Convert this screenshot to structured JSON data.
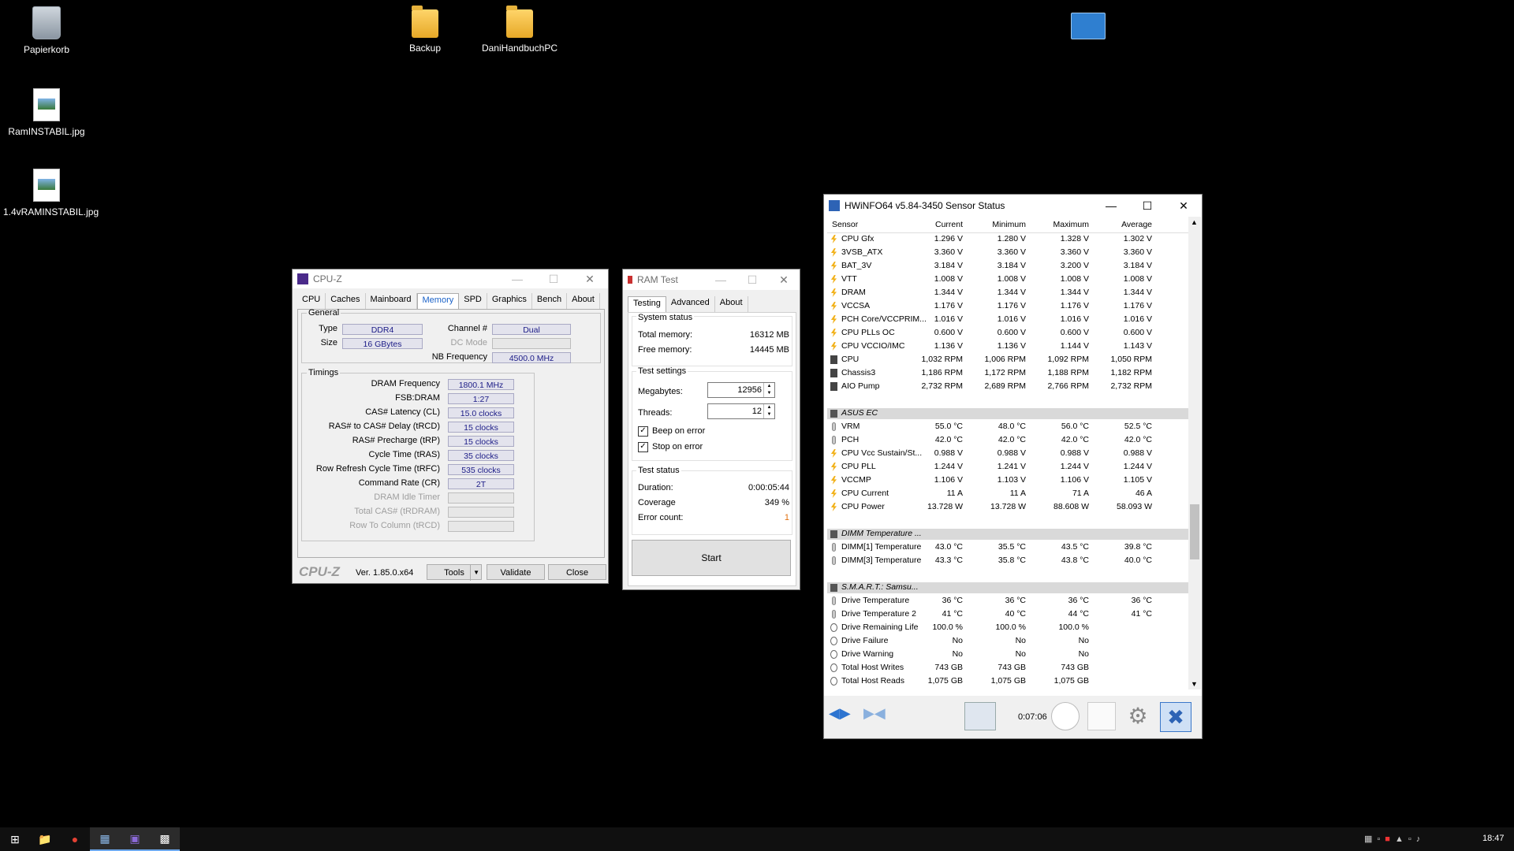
{
  "desktop": {
    "icons": [
      {
        "label": "Papierkorb"
      },
      {
        "label": "Backup"
      },
      {
        "label": "DaniHandbuchPC"
      },
      {
        "label": "RamINSTABIL.jpg"
      },
      {
        "label": "1.4vRAMINSTABIL.jpg"
      }
    ]
  },
  "cpuz": {
    "title": "CPU-Z",
    "tabs": [
      "CPU",
      "Caches",
      "Mainboard",
      "Memory",
      "SPD",
      "Graphics",
      "Bench",
      "About"
    ],
    "active_tab": "Memory",
    "general": {
      "legend": "General",
      "type_label": "Type",
      "type_value": "DDR4",
      "size_label": "Size",
      "size_value": "16 GBytes",
      "channel_label": "Channel #",
      "channel_value": "Dual",
      "dcmode_label": "DC Mode",
      "dcmode_value": "",
      "nbfreq_label": "NB Frequency",
      "nbfreq_value": "4500.0 MHz"
    },
    "timings": {
      "legend": "Timings",
      "rows": [
        {
          "label": "DRAM Frequency",
          "value": "1800.1 MHz"
        },
        {
          "label": "FSB:DRAM",
          "value": "1:27"
        },
        {
          "label": "CAS# Latency (CL)",
          "value": "15.0 clocks"
        },
        {
          "label": "RAS# to CAS# Delay (tRCD)",
          "value": "15 clocks"
        },
        {
          "label": "RAS# Precharge (tRP)",
          "value": "15 clocks"
        },
        {
          "label": "Cycle Time (tRAS)",
          "value": "35 clocks"
        },
        {
          "label": "Row Refresh Cycle Time (tRFC)",
          "value": "535 clocks"
        },
        {
          "label": "Command Rate (CR)",
          "value": "2T"
        },
        {
          "label": "DRAM Idle Timer",
          "value": ""
        },
        {
          "label": "Total CAS# (tRDRAM)",
          "value": ""
        },
        {
          "label": "Row To Column (tRCD)",
          "value": ""
        }
      ]
    },
    "footer": {
      "brand": "CPU-Z",
      "version": "Ver. 1.85.0.x64",
      "tools": "Tools",
      "validate": "Validate",
      "close": "Close"
    }
  },
  "ramtest": {
    "title": "RAM Test",
    "tabs": [
      "Testing",
      "Advanced",
      "About"
    ],
    "system_status": {
      "legend": "System status",
      "total_label": "Total memory:",
      "total_value": "16312 MB",
      "free_label": "Free memory:",
      "free_value": "14445 MB"
    },
    "settings": {
      "legend": "Test settings",
      "megabytes_label": "Megabytes:",
      "megabytes_value": "12956",
      "threads_label": "Threads:",
      "threads_value": "12",
      "beep_label": "Beep on error",
      "stop_label": "Stop on error"
    },
    "status": {
      "legend": "Test status",
      "duration_label": "Duration:",
      "duration_value": "0:00:05:44",
      "coverage_label": "Coverage",
      "coverage_value": "349 %",
      "errors_label": "Error count:",
      "errors_value": "1"
    },
    "start": "Start"
  },
  "hwinfo": {
    "title": "HWiNFO64 v5.84-3450 Sensor Status",
    "columns": [
      "Sensor",
      "Current",
      "Minimum",
      "Maximum",
      "Average"
    ],
    "rows": [
      {
        "kind": "volt",
        "name": "CPU Gfx",
        "cur": "1.296 V",
        "min": "1.280 V",
        "max": "1.328 V",
        "avg": "1.302 V"
      },
      {
        "kind": "volt",
        "name": "3VSB_ATX",
        "cur": "3.360 V",
        "min": "3.360 V",
        "max": "3.360 V",
        "avg": "3.360 V"
      },
      {
        "kind": "volt",
        "name": "BAT_3V",
        "cur": "3.184 V",
        "min": "3.184 V",
        "max": "3.200 V",
        "avg": "3.184 V"
      },
      {
        "kind": "volt",
        "name": "VTT",
        "cur": "1.008 V",
        "min": "1.008 V",
        "max": "1.008 V",
        "avg": "1.008 V"
      },
      {
        "kind": "volt",
        "name": "DRAM",
        "cur": "1.344 V",
        "min": "1.344 V",
        "max": "1.344 V",
        "avg": "1.344 V"
      },
      {
        "kind": "volt",
        "name": "VCCSA",
        "cur": "1.176 V",
        "min": "1.176 V",
        "max": "1.176 V",
        "avg": "1.176 V"
      },
      {
        "kind": "volt",
        "name": "PCH Core/VCCPRIM...",
        "cur": "1.016 V",
        "min": "1.016 V",
        "max": "1.016 V",
        "avg": "1.016 V"
      },
      {
        "kind": "volt",
        "name": "CPU PLLs OC",
        "cur": "0.600 V",
        "min": "0.600 V",
        "max": "0.600 V",
        "avg": "0.600 V"
      },
      {
        "kind": "volt",
        "name": "CPU VCCIO/IMC",
        "cur": "1.136 V",
        "min": "1.136 V",
        "max": "1.144 V",
        "avg": "1.143 V"
      },
      {
        "kind": "fan",
        "name": "CPU",
        "cur": "1,032 RPM",
        "min": "1,006 RPM",
        "max": "1,092 RPM",
        "avg": "1,050 RPM"
      },
      {
        "kind": "fan",
        "name": "Chassis3",
        "cur": "1,186 RPM",
        "min": "1,172 RPM",
        "max": "1,188 RPM",
        "avg": "1,182 RPM"
      },
      {
        "kind": "fan",
        "name": "AIO Pump",
        "cur": "2,732 RPM",
        "min": "2,689 RPM",
        "max": "2,766 RPM",
        "avg": "2,732 RPM"
      },
      {
        "kind": "blank"
      },
      {
        "kind": "group",
        "name": "ASUS EC"
      },
      {
        "kind": "temp",
        "name": "VRM",
        "cur": "55.0 °C",
        "min": "48.0 °C",
        "max": "56.0 °C",
        "avg": "52.5 °C"
      },
      {
        "kind": "temp",
        "name": "PCH",
        "cur": "42.0 °C",
        "min": "42.0 °C",
        "max": "42.0 °C",
        "avg": "42.0 °C"
      },
      {
        "kind": "volt",
        "name": "CPU Vcc Sustain/St...",
        "cur": "0.988 V",
        "min": "0.988 V",
        "max": "0.988 V",
        "avg": "0.988 V"
      },
      {
        "kind": "volt",
        "name": "CPU PLL",
        "cur": "1.244 V",
        "min": "1.241 V",
        "max": "1.244 V",
        "avg": "1.244 V"
      },
      {
        "kind": "volt",
        "name": "VCCMP",
        "cur": "1.106 V",
        "min": "1.103 V",
        "max": "1.106 V",
        "avg": "1.105 V"
      },
      {
        "kind": "volt",
        "name": "CPU Current",
        "cur": "11 A",
        "min": "11 A",
        "max": "71 A",
        "avg": "46 A"
      },
      {
        "kind": "volt",
        "name": "CPU Power",
        "cur": "13.728 W",
        "min": "13.728 W",
        "max": "88.608 W",
        "avg": "58.093 W"
      },
      {
        "kind": "blank"
      },
      {
        "kind": "group",
        "name": "DIMM Temperature ..."
      },
      {
        "kind": "temp",
        "name": "DIMM[1] Temperature",
        "cur": "43.0 °C",
        "min": "35.5 °C",
        "max": "43.5 °C",
        "avg": "39.8 °C"
      },
      {
        "kind": "temp",
        "name": "DIMM[3] Temperature",
        "cur": "43.3 °C",
        "min": "35.8 °C",
        "max": "43.8 °C",
        "avg": "40.0 °C"
      },
      {
        "kind": "blank"
      },
      {
        "kind": "group",
        "name": "S.M.A.R.T.: Samsu..."
      },
      {
        "kind": "temp",
        "name": "Drive Temperature",
        "cur": "36 °C",
        "min": "36 °C",
        "max": "36 °C",
        "avg": "36 °C"
      },
      {
        "kind": "temp",
        "name": "Drive Temperature 2",
        "cur": "41 °C",
        "min": "40 °C",
        "max": "44 °C",
        "avg": "41 °C"
      },
      {
        "kind": "disk",
        "name": "Drive Remaining Life",
        "cur": "100.0 %",
        "min": "100.0 %",
        "max": "100.0 %",
        "avg": ""
      },
      {
        "kind": "disk",
        "name": "Drive Failure",
        "cur": "No",
        "min": "No",
        "max": "No",
        "avg": ""
      },
      {
        "kind": "disk",
        "name": "Drive Warning",
        "cur": "No",
        "min": "No",
        "max": "No",
        "avg": ""
      },
      {
        "kind": "disk",
        "name": "Total Host Writes",
        "cur": "743 GB",
        "min": "743 GB",
        "max": "743 GB",
        "avg": ""
      },
      {
        "kind": "disk",
        "name": "Total Host Reads",
        "cur": "1,075 GB",
        "min": "1,075 GB",
        "max": "1,075 GB",
        "avg": ""
      }
    ],
    "elapsed": "0:07:06"
  },
  "taskbar": {
    "clock": "18:47"
  }
}
